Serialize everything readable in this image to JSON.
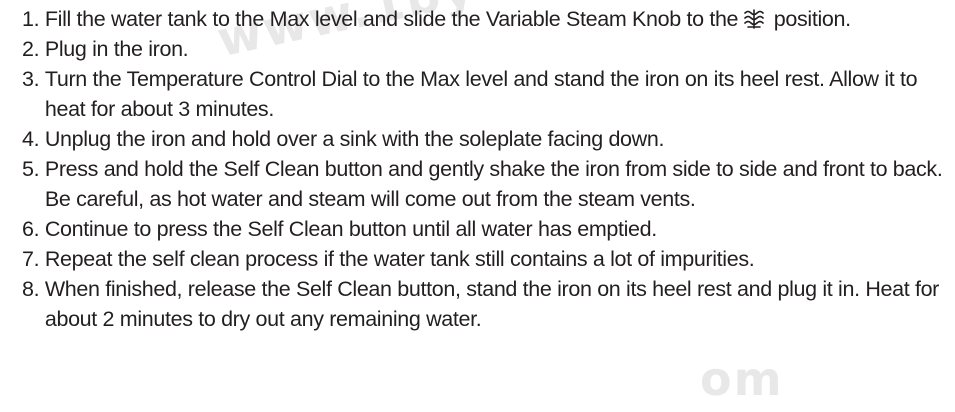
{
  "watermark": {
    "top": "www.1byo",
    "bottom": "om"
  },
  "steps": [
    {
      "number": "1. ",
      "text_before_icon": "Fill the water tank to the Max level and slide the Variable Steam Knob to the",
      "icon": "max-steam-icon",
      "text_after_icon": " position."
    },
    {
      "number": "2. ",
      "text": "Plug in the iron."
    },
    {
      "number": "3. ",
      "text": "Turn the Temperature Control Dial to the Max level and stand the iron on its heel rest. Allow it to heat for about 3 minutes."
    },
    {
      "number": "4. ",
      "text": "Unplug the iron and hold over a sink with the soleplate facing down."
    },
    {
      "number": "5. ",
      "text": "Press and hold the Self Clean button and gently shake the iron from side to side and front to back. Be careful, as hot water and steam will come out from the steam vents."
    },
    {
      "number": "6. ",
      "text": "Continue to press the Self Clean button until all water has emptied."
    },
    {
      "number": "7. ",
      "text": "Repeat the self clean process if the water tank still contains a lot of impurities."
    },
    {
      "number": "8. ",
      "text": "When finished, release the Self Clean button, stand the iron on its heel rest and plug it in. Heat for about 2 minutes to dry out any remaining water."
    }
  ]
}
